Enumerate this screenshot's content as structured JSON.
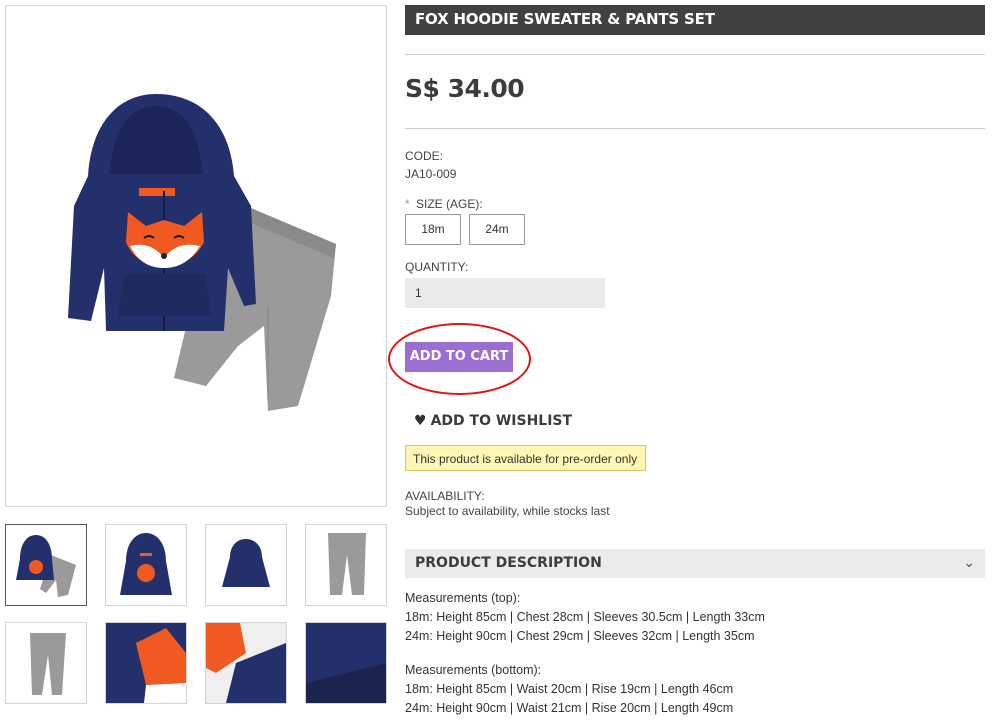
{
  "product": {
    "title": "FOX HOODIE SWEATER & PANTS SET",
    "price": "S$ 34.00",
    "code_label": "CODE:",
    "code_value": "JA10-009",
    "size_label": "SIZE (AGE):",
    "size_required_mark": "*",
    "sizes": [
      "18m",
      "24m"
    ],
    "quantity_label": "QUANTITY:",
    "quantity_value": "1",
    "add_to_cart": "ADD TO CART",
    "add_to_wishlist": "ADD TO WISHLIST",
    "preorder_notice": "This product is available for pre-order only",
    "availability_label": "AVAILABILITY:",
    "availability_value": "Subject to availability, while stocks last"
  },
  "description": {
    "header": "PRODUCT DESCRIPTION",
    "top_label": "Measurements (top):",
    "top_18m": "18m: Height 85cm | Chest 28cm | Sleeves 30.5cm | Length 33cm",
    "top_24m": "24m: Height 90cm | Chest 29cm | Sleeves 32cm | Length 35cm",
    "bottom_label": "Measurements (bottom):",
    "bottom_18m": "18m: Height 85cm | Waist 20cm | Rise 19cm | Length 46cm",
    "bottom_24m": "24m: Height 90cm | Waist 21cm | Rise 20cm | Length 49cm"
  },
  "colors": {
    "title_bg": "#414141",
    "cart_button": "#9b6fd1",
    "highlight_circle": "#e21212",
    "notice_bg": "#fff7b3",
    "hoodie": "#24306b",
    "pants": "#9a9a9a",
    "fox": "#f05a22"
  },
  "icons": [
    "heart-icon",
    "chevron-down-icon"
  ]
}
